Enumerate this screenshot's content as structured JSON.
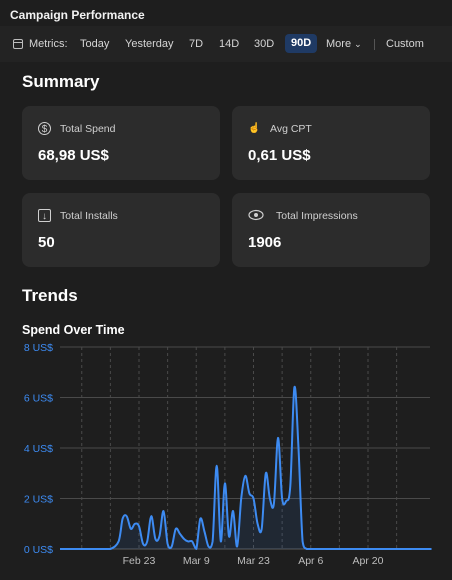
{
  "window": {
    "title": "Campaign Performance"
  },
  "toolbar": {
    "metrics_label": "Metrics:",
    "ranges": [
      "Today",
      "Yesterday",
      "7D",
      "14D",
      "30D",
      "90D"
    ],
    "selected": "90D",
    "more_label": "More",
    "custom_label": "Custom"
  },
  "summary": {
    "heading": "Summary",
    "cards": [
      {
        "label": "Total Spend",
        "value": "68,98 US$",
        "icon": "dollar-circle-icon"
      },
      {
        "label": "Avg CPT",
        "value": "0,61 US$",
        "icon": "hand-tap-icon"
      },
      {
        "label": "Total Installs",
        "value": "50",
        "icon": "download-icon"
      },
      {
        "label": "Total Impressions",
        "value": "1906",
        "icon": "eye-icon"
      }
    ]
  },
  "trends": {
    "heading": "Trends",
    "chart_title": "Spend Over Time"
  },
  "colors": {
    "accent": "#3d8bf2",
    "selected_bg": "#1f3a64",
    "card_bg": "#2c2c2c"
  },
  "chart_data": {
    "type": "line",
    "title": "Spend Over Time",
    "xlabel": "",
    "ylabel": "",
    "ylim": [
      0,
      8
    ],
    "yticks": [
      "0 US$",
      "2 US$",
      "4 US$",
      "6 US$",
      "8 US$"
    ],
    "xticks": [
      "Feb 23",
      "Mar 9",
      "Mar 23",
      "Apr 6",
      "Apr 20"
    ],
    "grid": true,
    "series": [
      {
        "x": [
          "Feb 5",
          "Feb 8",
          "Feb 11",
          "Feb 14",
          "Feb 16",
          "Feb 18",
          "Feb 19",
          "Feb 20",
          "Feb 21",
          "Feb 22",
          "Feb 23",
          "Feb 24",
          "Feb 25",
          "Feb 26",
          "Feb 27",
          "Feb 28",
          "Mar 1",
          "Mar 2",
          "Mar 3",
          "Mar 4",
          "Mar 5",
          "Mar 6",
          "Mar 7",
          "Mar 8",
          "Mar 9",
          "Mar 10",
          "Mar 11",
          "Mar 12",
          "Mar 13",
          "Mar 14",
          "Mar 15",
          "Mar 16",
          "Mar 17",
          "Mar 18",
          "Mar 19",
          "Mar 20",
          "Mar 21",
          "Mar 22",
          "Mar 23",
          "Mar 24",
          "Mar 25",
          "Mar 26",
          "Mar 27",
          "Mar 28",
          "Mar 29",
          "Mar 30",
          "Mar 31",
          "Apr 1",
          "Apr 2",
          "Apr 3",
          "Apr 4",
          "Apr 5",
          "Apr 7",
          "Apr 10",
          "Apr 15",
          "Apr 20",
          "Apr 25",
          "May 1",
          "May 5"
        ],
        "values": [
          0,
          0,
          0,
          0,
          0,
          0.3,
          1.2,
          1.3,
          0.8,
          1.0,
          0.9,
          0.2,
          0.3,
          1.3,
          0.4,
          0.5,
          1.5,
          0.2,
          0.1,
          0.8,
          0.6,
          0.4,
          0.3,
          0.3,
          0.0,
          1.2,
          0.7,
          0.1,
          0.3,
          3.3,
          0.3,
          2.6,
          0.5,
          1.5,
          0.1,
          2.0,
          2.9,
          2.2,
          2.0,
          1.0,
          0.8,
          3.0,
          2.0,
          1.8,
          4.4,
          2.0,
          1.9,
          2.5,
          6.4,
          4.0,
          0.3,
          0,
          0,
          0,
          0,
          0,
          0,
          0,
          0
        ]
      }
    ]
  }
}
